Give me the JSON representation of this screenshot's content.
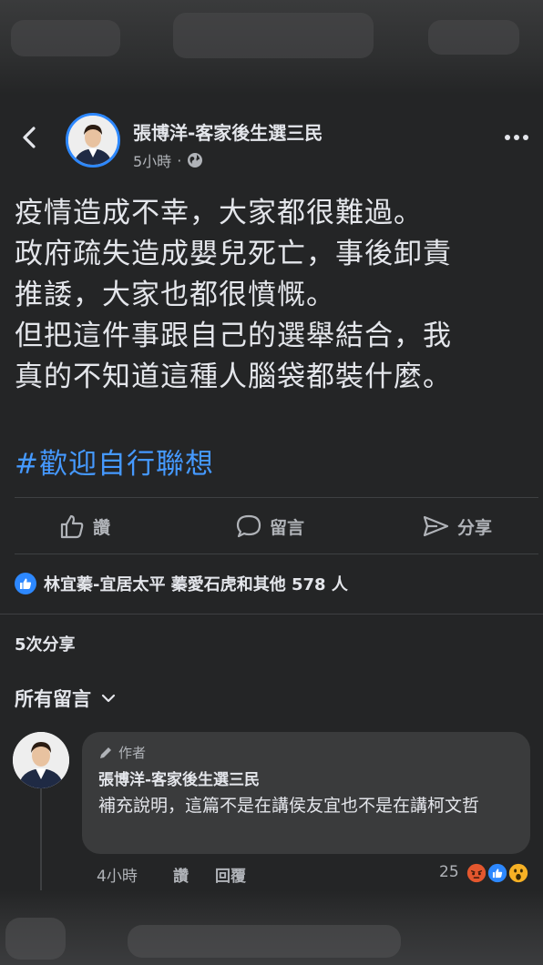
{
  "post": {
    "author": "張博洋-客家後生選三民",
    "time": "5小時",
    "separator": "·",
    "body_lines": [
      "疫情造成不幸，大家都很難過。",
      "政府疏失造成嬰兒死亡，事後卸責",
      "推諉，大家也都很憤慨。",
      "但把這件事跟自己的選舉結合，我",
      "真的不知道這種人腦袋都裝什麼。"
    ],
    "hashtag": "#歡迎自行聯想"
  },
  "actions": {
    "like": "讚",
    "comment": "留言",
    "share": "分享"
  },
  "reactions": {
    "summary": "林宜蓁-宜居太平 蓁愛石虎和其他 578 人"
  },
  "shares": "5次分享",
  "comments_filter": "所有留言",
  "comment": {
    "badge": "作者",
    "author": "張博洋-客家後生選三民",
    "text": "補充說明，這篇不是在講侯友宜也不是在講柯文哲",
    "time": "4小時",
    "like_label": "讚",
    "reply_label": "回覆",
    "reaction_count": "25",
    "reaction_icons": [
      "angry-icon",
      "like-icon",
      "wow-icon"
    ]
  },
  "colors": {
    "background": "#242526",
    "accent": "#2d88ff",
    "hashtag": "#4599ff",
    "secondary_text": "#b0b3b8"
  }
}
